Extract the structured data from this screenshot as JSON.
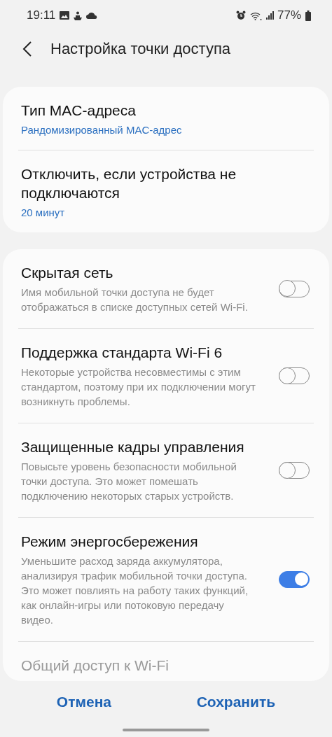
{
  "status_bar": {
    "time": "19:11",
    "battery": "77%"
  },
  "header": {
    "title": "Настройка точки доступа"
  },
  "groups": [
    {
      "items": [
        {
          "kind": "value",
          "title": "Тип MAC-адреса",
          "value": "Рандомизированный MAC-адрес"
        },
        {
          "kind": "value",
          "title": "Отключить, если устройства не подключаются",
          "value": "20 минут"
        }
      ]
    },
    {
      "items": [
        {
          "kind": "switch",
          "title": "Скрытая сеть",
          "description": "Имя мобильной точки доступа не будет отображаться в списке доступных сетей Wi-Fi.",
          "on": false,
          "disabled": false
        },
        {
          "kind": "switch",
          "title": "Поддержка стандарта Wi-Fi 6",
          "description": "Некоторые устройства несовместимы с этим стандартом, поэтому при их подключении могут возникнуть проблемы.",
          "on": false,
          "disabled": false
        },
        {
          "kind": "switch",
          "title": "Защищенные кадры управления",
          "description": "Повысьте уровень безопасности мобильной точки доступа. Это может помешать подключению некоторых старых устройств.",
          "on": false,
          "disabled": false
        },
        {
          "kind": "switch",
          "title": "Режим энергосбережения",
          "description": "Уменьшите расход заряда аккумулятора, анализируя трафик мобильной точки доступа. Это может повлиять на работу таких функций, как онлайн-игры или потоковую передачу видео.",
          "on": true,
          "disabled": false
        },
        {
          "kind": "title",
          "title": "Общий доступ к Wi-Fi",
          "disabled": true
        }
      ]
    }
  ],
  "buttons": [
    {
      "label": "Отмена"
    },
    {
      "label": "Сохранить"
    }
  ]
}
